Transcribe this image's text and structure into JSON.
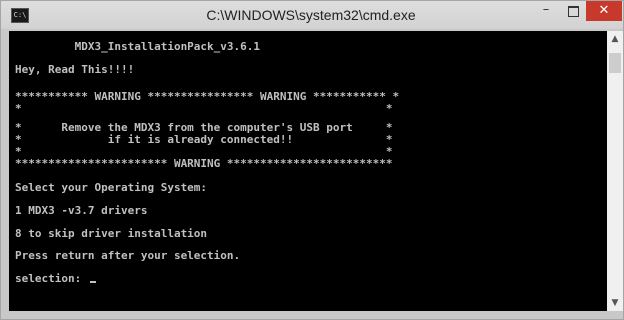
{
  "window": {
    "title": "C:\\WINDOWS\\system32\\cmd.exe",
    "icon_label": "C:\\",
    "minimize_glyph": "–",
    "close_glyph": "✕"
  },
  "console": {
    "lines": [
      "         MDX3_InstallationPack_v3.6.1",
      "Hey, Read This!!!!",
      "*********** WARNING **************** WARNING *********** *",
      "*                                                       *",
      "*      Remove the MDX3 from the computer's USB port     *",
      "*             if it is already connected!!              *",
      "*                                                       *",
      "*********************** WARNING *************************",
      "Select your Operating System:",
      "1 MDX3 -v3.7 drivers",
      "8 to skip driver installation",
      "Press return after your selection.",
      "selection: "
    ]
  },
  "scrollbar": {
    "up_glyph": "▲",
    "down_glyph": "▼"
  },
  "colors": {
    "console_bg": "#000000",
    "console_text": "#c0c0c0",
    "close_button": "#c7392b"
  }
}
